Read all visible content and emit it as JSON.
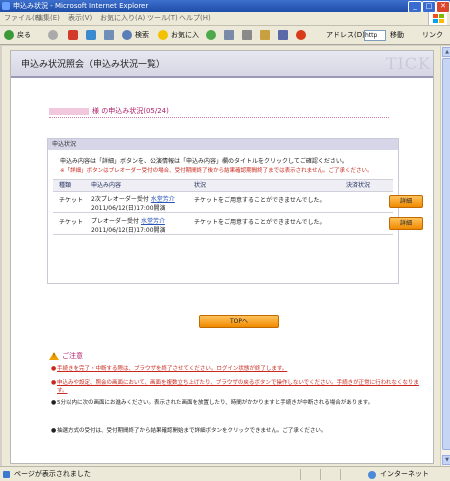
{
  "window": {
    "title": "申込み状況 - Microsoft Internet Explorer",
    "btn_min": "_",
    "btn_max": "□",
    "btn_close": "✕"
  },
  "menu": [
    "ファイル(F)",
    "編集(E)",
    "表示(V)",
    "お気に入り(A)",
    "ツール(T)",
    "ヘルプ(H)"
  ],
  "toolbar": {
    "back": "戻る",
    "search": "検索",
    "favorites": "お気に入り",
    "address_label": "アドレス(D)",
    "address_value": "http",
    "go": "移動",
    "links": "リンク"
  },
  "page": {
    "header_title": "申込み状況照会（申込み状況一覧）",
    "logo_text": "TICK",
    "user_line": "様 の申込み状況(05/24)",
    "panel_title": "申込状況",
    "desc1": "申込み内容は「詳細」ボタンを、公演情報は「申込み内容」欄のタイトルをクリックしてご確認ください。",
    "desc2": "※「詳細」ボタンはプレオーダー受付の場合、受付期間終了後から結果確認期間終了までは表示されません。ご了承ください。",
    "table": {
      "headers": [
        "種類",
        "申込み内容",
        "状況",
        "決済状況"
      ],
      "rows": [
        {
          "type": "チケット",
          "content_line1": "2次プレオーダー受付",
          "content_link": "水堂芳介",
          "content_line2": "2011/06/12(日)17:00開演",
          "status": "チケットをご用意することができませんでした。",
          "button": "詳細"
        },
        {
          "type": "チケット",
          "content_line1": "プレオーダー受付",
          "content_link": "水堂芳介",
          "content_line2": "2011/06/12(日)17:00開演",
          "status": "チケットをご用意することができませんでした。",
          "button": "詳細"
        }
      ]
    },
    "top_button": "TOPへ",
    "notes_title": "ご注意",
    "notes": [
      {
        "style": "red",
        "text": "手続きを完了・中断する際は、ブラウザを終了させてください。ログイン状態が終了します。"
      },
      {
        "style": "red",
        "text": "申込みや設定、照会の画面において、画面を複数立ち上げたり、ブラウザの戻るボタンで操作しないでください。手続きが正常に行われなくなります。"
      },
      {
        "style": "blk",
        "text": "5分以内に次の画面にお進みください。表示された画面を放置したり、時間がかかりますと手続きが中断される場合があります。"
      },
      {
        "style": "blk",
        "text": "抽選方式の受付は、受付期間終了から結果確認開始まで詳細ボタンをクリックできません。ご了承ください。"
      }
    ]
  },
  "statusbar": {
    "left": "ページが表示されました",
    "right": "インターネット"
  }
}
